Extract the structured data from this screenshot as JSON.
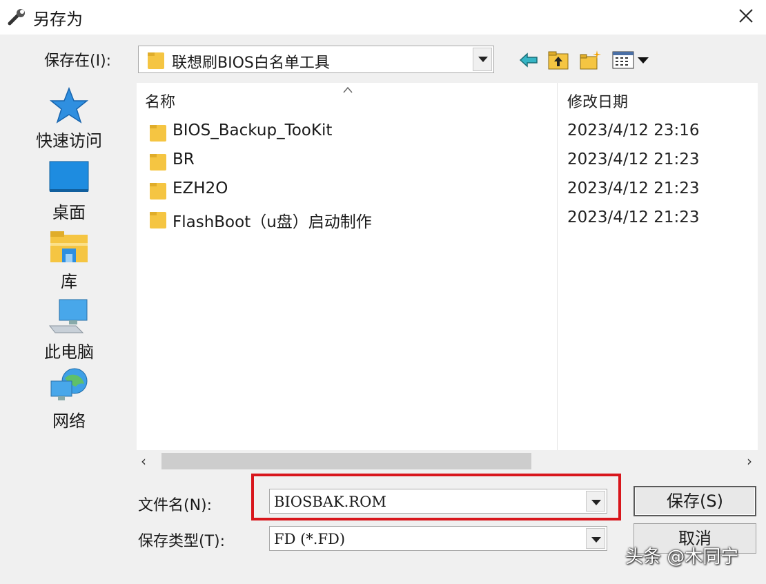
{
  "window": {
    "title": "另存为"
  },
  "toolbar": {
    "save_in_label": "保存在(I):",
    "current_folder": "联想刷BIOS白名单工具",
    "icons": [
      "back-arrow-icon",
      "up-folder-icon",
      "new-folder-icon",
      "view-menu-icon"
    ]
  },
  "places": [
    {
      "label": "快速访问",
      "icon": "star-icon"
    },
    {
      "label": "桌面",
      "icon": "desktop-icon"
    },
    {
      "label": "库",
      "icon": "library-folder-icon"
    },
    {
      "label": "此电脑",
      "icon": "computer-icon"
    },
    {
      "label": "网络",
      "icon": "network-icon"
    }
  ],
  "filelist": {
    "columns": {
      "name": "名称",
      "date": "修改日期"
    },
    "rows": [
      {
        "name": "BIOS_Backup_TooKit",
        "date": "2023/4/12 23:16"
      },
      {
        "name": "BR",
        "date": "2023/4/12 21:23"
      },
      {
        "name": "EZH2O",
        "date": "2023/4/12 21:23"
      },
      {
        "name": "FlashBoot（u盘）启动制作",
        "date": "2023/4/12 21:23"
      }
    ]
  },
  "form": {
    "filename_label": "文件名(N):",
    "filename_value": "BIOSBAK.ROM",
    "filetype_label": "保存类型(T):",
    "filetype_value": "FD (*.FD)"
  },
  "buttons": {
    "save": "保存(S)",
    "cancel": "取消"
  },
  "watermark": "头条 @木同宁",
  "colors": {
    "highlight": "#d8161c",
    "folder": "#f5c542"
  }
}
